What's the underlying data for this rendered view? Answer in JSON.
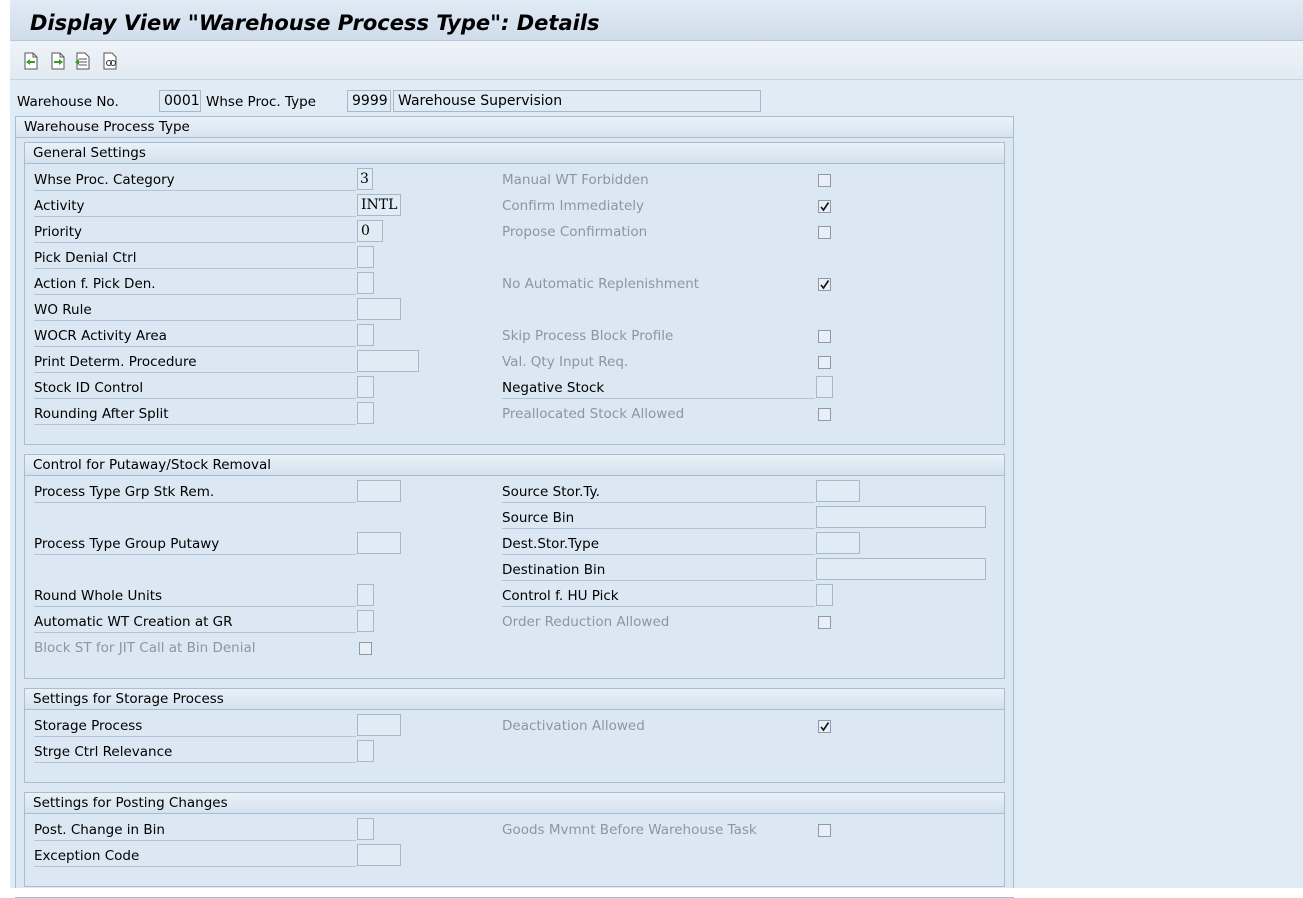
{
  "window": {
    "title": "Display View \"Warehouse Process Type\": Details"
  },
  "toolbar": {
    "buttons": [
      "prev-entry-icon",
      "next-entry-icon",
      "select-entry-icon",
      "find-icon"
    ]
  },
  "header": {
    "warehouse_label": "Warehouse No.",
    "warehouse_value": "0001",
    "proc_type_label": "Whse Proc. Type",
    "proc_type_value": "9999",
    "proc_type_desc": "Warehouse Supervision"
  },
  "section_title": "Warehouse Process Type",
  "general": {
    "title": "General Settings",
    "left": [
      {
        "label": "Whse Proc. Category",
        "value": "3"
      },
      {
        "label": "Activity",
        "value": "INTL"
      },
      {
        "label": "Priority",
        "value": "0"
      },
      {
        "label": "Pick Denial Ctrl",
        "value": ""
      },
      {
        "label": "Action f. Pick Den.",
        "value": ""
      },
      {
        "label": "WO Rule",
        "value": ""
      },
      {
        "label": "WOCR Activity Area",
        "value": ""
      },
      {
        "label": "Print Determ. Procedure",
        "value": ""
      },
      {
        "label": "Stock ID Control",
        "value": ""
      },
      {
        "label": "Rounding After Split",
        "value": ""
      }
    ],
    "right": [
      {
        "label": "Manual WT Forbidden",
        "checked": false
      },
      {
        "label": "Confirm Immediately",
        "checked": true
      },
      {
        "label": "Propose Confirmation",
        "checked": false
      },
      {
        "label": "No Automatic Replenishment",
        "checked": true
      },
      {
        "label": "Skip Process Block Profile",
        "checked": false
      },
      {
        "label": "Val. Qty Input Req.",
        "checked": false
      },
      {
        "label": "Negative Stock",
        "value": ""
      },
      {
        "label": "Preallocated Stock Allowed",
        "checked": false
      }
    ]
  },
  "putaway": {
    "title": "Control for Putaway/Stock Removal",
    "left": [
      {
        "label": "Process Type Grp Stk Rem.",
        "value": ""
      },
      {
        "label": "Process Type Group Putawy",
        "value": ""
      },
      {
        "label": "Round Whole Units",
        "value": ""
      },
      {
        "label": "Automatic WT Creation at GR",
        "value": ""
      },
      {
        "label": "Block ST for JIT Call at Bin Denial",
        "checked": false
      }
    ],
    "right": [
      {
        "label": "Source Stor.Ty.",
        "value": ""
      },
      {
        "label": "Source Bin",
        "value": ""
      },
      {
        "label": "Dest.Stor.Type",
        "value": ""
      },
      {
        "label": "Destination Bin",
        "value": ""
      },
      {
        "label": "Control f. HU Pick",
        "value": ""
      },
      {
        "label": "Order Reduction Allowed",
        "checked": false
      }
    ]
  },
  "storage": {
    "title": "Settings for Storage Process",
    "left": [
      {
        "label": "Storage Process",
        "value": ""
      },
      {
        "label": "Strge Ctrl Relevance",
        "value": ""
      }
    ],
    "right": [
      {
        "label": "Deactivation Allowed",
        "checked": true
      }
    ]
  },
  "posting": {
    "title": "Settings for Posting Changes",
    "left": [
      {
        "label": "Post. Change in Bin",
        "value": ""
      },
      {
        "label": "Exception Code",
        "value": ""
      }
    ],
    "right": [
      {
        "label": "Goods Mvmnt Before Warehouse Task",
        "checked": false
      }
    ]
  }
}
